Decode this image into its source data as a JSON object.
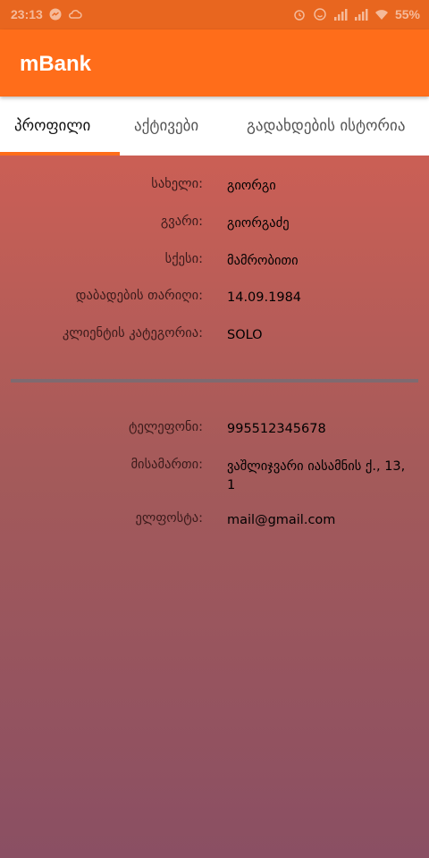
{
  "status_bar": {
    "time": "23:13",
    "battery": "55%",
    "icons": [
      "messenger-icon",
      "cloud-icon",
      "alarm-icon",
      "signal-icon",
      "signal-icon",
      "wifi-icon"
    ]
  },
  "app_bar": {
    "title": "mBank"
  },
  "tabs": [
    {
      "label": "პროფილი",
      "active": true
    },
    {
      "label": "აქტივები",
      "active": false
    },
    {
      "label": "გადახდების ისტორია",
      "active": false
    }
  ],
  "profile": {
    "personal": [
      {
        "label": "სახელი:",
        "value": "გიორგი"
      },
      {
        "label": "გვარი:",
        "value": "გიორგაძე"
      },
      {
        "label": "სქესი:",
        "value": "მამრობითი"
      },
      {
        "label": "დაბადების თარიღი:",
        "value": "14.09.1984"
      },
      {
        "label": "კლიენტის კატეგორია:",
        "value": "SOLO"
      }
    ],
    "contact": [
      {
        "label": "ტელეფონი:",
        "value": "995512345678"
      },
      {
        "label": "მისამართი:",
        "value": "ვაშლიჯვარი იასამნის ქ., 13, 1"
      },
      {
        "label": "ელფოსტა:",
        "value": "mail@gmail.com"
      }
    ]
  },
  "colors": {
    "accent": "#ff6d1a",
    "status_bar": "#e8661f",
    "gradient_top": "#cb5f55",
    "gradient_bottom": "#8a4f63"
  }
}
